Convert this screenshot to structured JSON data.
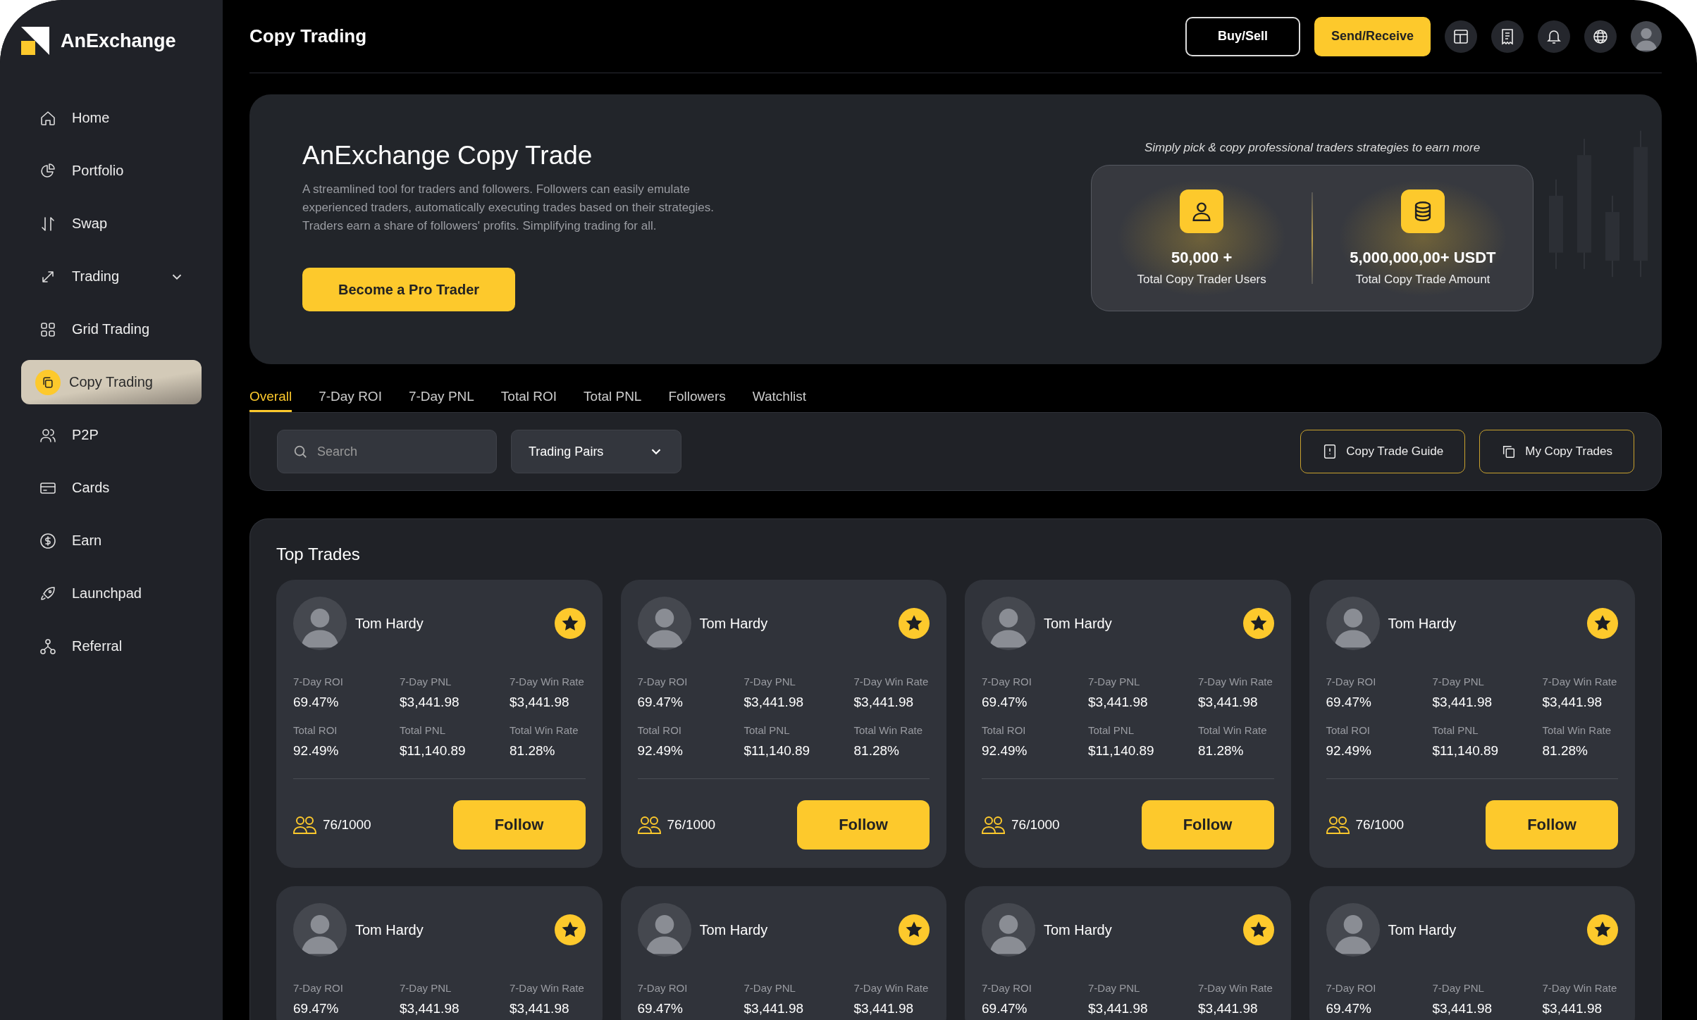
{
  "brand": {
    "name": "AnExchange"
  },
  "sidebar": {
    "items": [
      {
        "label": "Home",
        "selected": false,
        "submenu": false
      },
      {
        "label": "Portfolio",
        "selected": false,
        "submenu": false
      },
      {
        "label": "Swap",
        "selected": false,
        "submenu": false
      },
      {
        "label": "Trading",
        "selected": false,
        "submenu": true
      },
      {
        "label": "Grid Trading",
        "selected": false,
        "submenu": false
      },
      {
        "label": "Copy Trading",
        "selected": true,
        "submenu": false
      },
      {
        "label": "P2P",
        "selected": false,
        "submenu": false
      },
      {
        "label": "Cards",
        "selected": false,
        "submenu": false
      },
      {
        "label": "Earn",
        "selected": false,
        "submenu": false
      },
      {
        "label": "Launchpad",
        "selected": false,
        "submenu": false
      },
      {
        "label": "Referral",
        "selected": false,
        "submenu": false
      }
    ]
  },
  "header": {
    "title": "Copy Trading",
    "buttons": [
      {
        "label": "Buy/Sell",
        "kind": "outline"
      },
      {
        "label": "Send/Receive",
        "kind": "primary"
      }
    ]
  },
  "banner": {
    "title": "AnExchange Copy Trade",
    "description": "A streamlined tool for traders and followers. Followers can easily emulate experienced traders, automatically executing trades based on their strategies. Traders earn a share of followers' profits. Simplifying trading for all.",
    "button": "Become a Pro Trader",
    "tagline": "Simply pick & copy professional traders strategies to earn more",
    "stats": [
      {
        "value": "50,000 +",
        "label": "Total Copy Trader Users"
      },
      {
        "value": "5,000,000,00+ USDT",
        "label": "Total Copy Trade Amount"
      }
    ]
  },
  "tabs": [
    {
      "label": "Overall",
      "selected": true
    },
    {
      "label": "7-Day ROI",
      "selected": false
    },
    {
      "label": "7-Day PNL",
      "selected": false
    },
    {
      "label": "Total ROI",
      "selected": false
    },
    {
      "label": "Total PNL",
      "selected": false
    },
    {
      "label": "Followers",
      "selected": false
    },
    {
      "label": "Watchlist",
      "selected": false
    }
  ],
  "filters": {
    "search": {
      "placeholder": "Search"
    },
    "trading_pairs": {
      "value": "Trading Pairs"
    },
    "buttons": [
      "Copy Trade Guide",
      "My Copy Trades"
    ]
  },
  "top_trades": {
    "title": "Top Trades",
    "cards": [
      {
        "name": "Tom Hardy",
        "starred": true,
        "stats": [
          {
            "label": "7-Day ROI",
            "value": "69.47%"
          },
          {
            "label": "7-Day PNL",
            "value": "$3,441.98"
          },
          {
            "label": "7-Day Win Rate",
            "value": "$3,441.98"
          },
          {
            "label": "Total ROI",
            "value": "92.49%"
          },
          {
            "label": "Total PNL",
            "value": "$11,140.89"
          },
          {
            "label": "Total Win Rate",
            "value": "81.28%"
          }
        ],
        "followers": "76/1000",
        "button": "Follow"
      },
      {
        "name": "Tom Hardy",
        "starred": true,
        "stats": [
          {
            "label": "7-Day ROI",
            "value": "69.47%"
          },
          {
            "label": "7-Day PNL",
            "value": "$3,441.98"
          },
          {
            "label": "7-Day Win Rate",
            "value": "$3,441.98"
          },
          {
            "label": "Total ROI",
            "value": "92.49%"
          },
          {
            "label": "Total PNL",
            "value": "$11,140.89"
          },
          {
            "label": "Total Win Rate",
            "value": "81.28%"
          }
        ],
        "followers": "76/1000",
        "button": "Follow"
      },
      {
        "name": "Tom Hardy",
        "starred": true,
        "stats": [
          {
            "label": "7-Day ROI",
            "value": "69.47%"
          },
          {
            "label": "7-Day PNL",
            "value": "$3,441.98"
          },
          {
            "label": "7-Day Win Rate",
            "value": "$3,441.98"
          },
          {
            "label": "Total ROI",
            "value": "92.49%"
          },
          {
            "label": "Total PNL",
            "value": "$11,140.89"
          },
          {
            "label": "Total Win Rate",
            "value": "81.28%"
          }
        ],
        "followers": "76/1000",
        "button": "Follow"
      },
      {
        "name": "Tom Hardy",
        "starred": true,
        "stats": [
          {
            "label": "7-Day ROI",
            "value": "69.47%"
          },
          {
            "label": "7-Day PNL",
            "value": "$3,441.98"
          },
          {
            "label": "7-Day Win Rate",
            "value": "$3,441.98"
          },
          {
            "label": "Total ROI",
            "value": "92.49%"
          },
          {
            "label": "Total PNL",
            "value": "$11,140.89"
          },
          {
            "label": "Total Win Rate",
            "value": "81.28%"
          }
        ],
        "followers": "76/1000",
        "button": "Follow"
      },
      {
        "name": "Tom Hardy",
        "starred": true,
        "stats": [
          {
            "label": "7-Day ROI",
            "value": "69.47%"
          },
          {
            "label": "7-Day PNL",
            "value": "$3,441.98"
          },
          {
            "label": "7-Day Win Rate",
            "value": "$3,441.98"
          }
        ]
      },
      {
        "name": "Tom Hardy",
        "starred": true,
        "stats": [
          {
            "label": "7-Day ROI",
            "value": "69.47%"
          },
          {
            "label": "7-Day PNL",
            "value": "$3,441.98"
          },
          {
            "label": "7-Day Win Rate",
            "value": "$3,441.98"
          }
        ]
      },
      {
        "name": "Tom Hardy",
        "starred": true,
        "stats": [
          {
            "label": "7-Day ROI",
            "value": "69.47%"
          },
          {
            "label": "7-Day PNL",
            "value": "$3,441.98"
          },
          {
            "label": "7-Day Win Rate",
            "value": "$3,441.98"
          }
        ]
      },
      {
        "name": "Tom Hardy",
        "starred": true,
        "stats": [
          {
            "label": "7-Day ROI",
            "value": "69.47%"
          },
          {
            "label": "7-Day PNL",
            "value": "$3,441.98"
          },
          {
            "label": "7-Day Win Rate",
            "value": "$3,441.98"
          }
        ]
      }
    ]
  }
}
